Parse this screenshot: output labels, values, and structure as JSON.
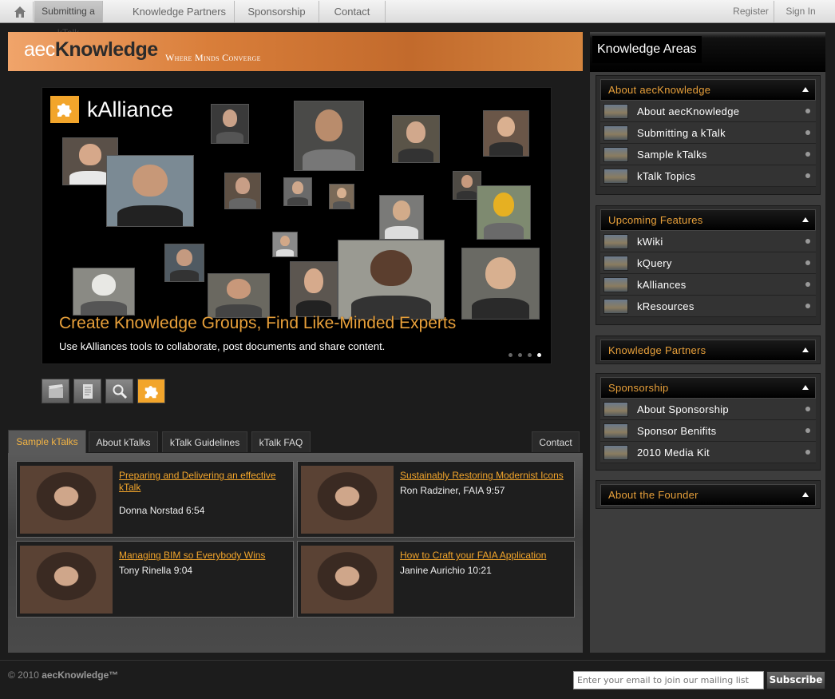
{
  "topnav": {
    "items": [
      "Submitting a kTalk",
      "Knowledge Partners",
      "Sponsorship",
      "Contact"
    ],
    "register": "Register",
    "signin": "Sign In"
  },
  "banner": {
    "logo_light": "aec",
    "logo_bold": "Knowledge",
    "tagline": "Where Minds Converge"
  },
  "hero": {
    "brand": "kAlliance",
    "headline": "Create Knowledge Groups, Find Like-Minded Experts",
    "subline": "Use kAlliances tools to collaborate, post documents and share content.",
    "slide_count": 4,
    "active_slide": 4
  },
  "tabs": {
    "items": [
      "Sample kTalks",
      "About kTalks",
      "kTalk Guidelines",
      "kTalk FAQ"
    ],
    "active": "Sample kTalks",
    "contact": "Contact"
  },
  "talks": [
    {
      "title": "Preparing and Delivering an effective kTalk",
      "speaker": "Donna Norstad 6:54"
    },
    {
      "title": "Sustainably Restoring Modernist Icons",
      "speaker": "Ron Radziner, FAIA 9:57"
    },
    {
      "title": "Managing BIM so Everybody Wins",
      "speaker": "Tony Rinella 9:04"
    },
    {
      "title": "How to Craft your FAIA Application",
      "speaker": "Janine Aurichio 10:21"
    }
  ],
  "sidebar": {
    "title": "Knowledge Areas",
    "sections": [
      {
        "title": "About aecKnowledge",
        "items": [
          "About aecKnowledge",
          "Submitting a kTalk",
          "Sample kTalks",
          "kTalk Topics"
        ]
      },
      {
        "title": "Upcoming Features",
        "items": [
          "kWiki",
          "kQuery",
          "kAlliances",
          "kResources"
        ]
      },
      {
        "title": "Knowledge Partners",
        "items": []
      },
      {
        "title": "Sponsorship",
        "items": [
          "About Sponsorship",
          "Sponsor Benifits",
          "2010 Media Kit"
        ]
      },
      {
        "title": "About the Founder",
        "items": []
      }
    ]
  },
  "footer": {
    "copyright_prefix": "© 2010 ",
    "copyright_brand": "aecKnowledge™",
    "email_placeholder": "Enter your email to join our mailing list",
    "subscribe": "Subscribe"
  },
  "colors": {
    "accent": "#f2a52b",
    "banner": "#d97e3a",
    "background": "#1c1c1c"
  }
}
